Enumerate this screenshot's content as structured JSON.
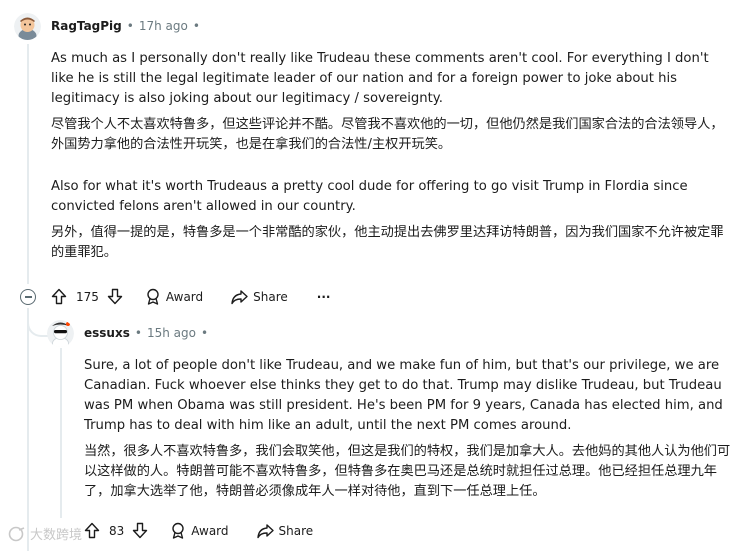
{
  "comment1": {
    "author": "RagTagPig",
    "time": "17h ago",
    "paragraphs": [
      {
        "text": "As much as I personally don't really like Trudeau these comments aren't cool. For everything I don't like he is still the legal legitimate leader of our nation and for a foreign power to joke about his legitimacy is also joking about our legitimacy / sovereignty.",
        "lang": "en"
      },
      {
        "text": "尽管我个人不太喜欢特鲁多，但这些评论并不酷。尽管我不喜欢他的一切，但他仍然是我们国家合法的合法领导人，外国势力拿他的合法性开玩笑，也是在拿我们的合法性/主权开玩笑。",
        "lang": "cn"
      },
      {
        "text": "Also for what it's worth Trudeaus a pretty cool dude for offering to go visit Trump in Flordia since convicted felons aren't allowed in our country.",
        "lang": "en"
      },
      {
        "text": "另外，值得一提的是，特鲁多是一个非常酷的家伙，他主动提出去佛罗里达拜访特朗普，因为我们国家不允许被定罪的重罪犯。",
        "lang": "cn"
      }
    ],
    "votes": "175",
    "award_label": "Award",
    "share_label": "Share",
    "more_label": "···"
  },
  "comment2": {
    "author": "essuxs",
    "time": "15h ago",
    "paragraphs": [
      {
        "text": "Sure, a lot of people don't like Trudeau, and we make fun of him, but that's our privilege, we are Canadian. Fuck whoever else thinks they get to do that. Trump may dislike Trudeau, but Trudeau was PM when Obama was still president. He's been PM for 9 years, Canada has elected him, and Trump has to deal with him like an adult, until the next PM comes around.",
        "lang": "en"
      },
      {
        "text": "当然，很多人不喜欢特鲁多，我们会取笑他，但这是我们的特权，我们是加拿大人。去他妈的其他人认为他们可以这样做的人。特朗普可能不喜欢特鲁多，但特鲁多在奥巴马还是总统时就担任过总理。他已经担任总理九年了，加拿大选举了他，特朗普必须像成年人一样对待他，直到下一任总理上任。",
        "lang": "cn"
      }
    ],
    "votes": "83",
    "award_label": "Award",
    "share_label": "Share"
  },
  "watermark": "大数跨境",
  "colors": {
    "text": "#1c1c1c",
    "meta": "#6b7a80",
    "thread": "#e5ebee"
  }
}
